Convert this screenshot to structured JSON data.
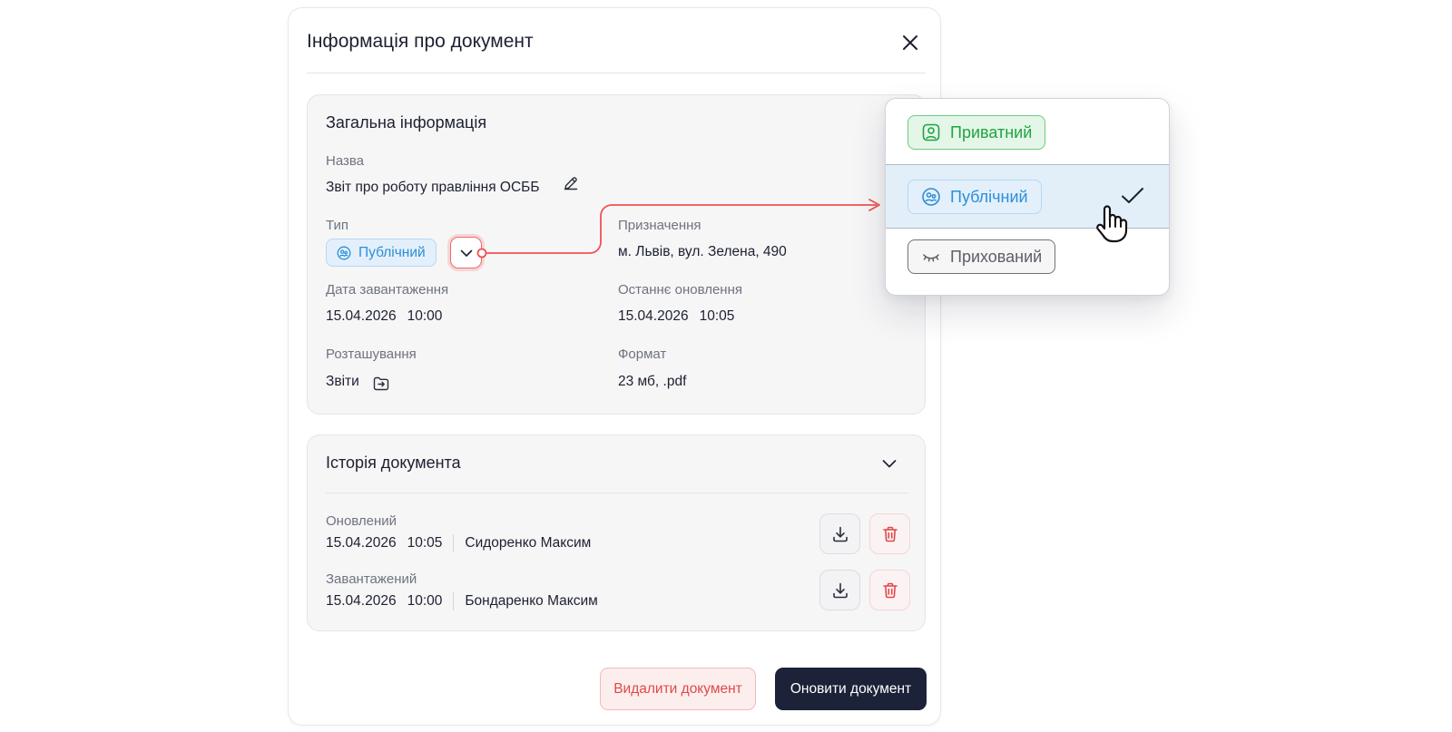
{
  "modal": {
    "title": "Інформація про документ"
  },
  "general": {
    "title": "Загальна інформація",
    "name_label": "Назва",
    "name_value": "Звіт про роботу правління ОСББ",
    "type_label": "Тип",
    "type_value": "Публічний",
    "purpose_label": "Призначення",
    "purpose_value": "м. Львів, вул. Зелена, 490",
    "upload_label": "Дата завантаження",
    "upload_date": "15.04.2026",
    "upload_time": "10:00",
    "updated_label": "Останнє оновлення",
    "updated_date": "15.04.2026",
    "updated_time": "10:05",
    "location_label": "Розташування",
    "location_value": "Звіти",
    "format_label": "Формат",
    "format_value": "23 мб, .pdf"
  },
  "history": {
    "title": "Історія документа",
    "entries": [
      {
        "status": "Оновлений",
        "date": "15.04.2026",
        "time": "10:05",
        "author": "Сидоренко Максим"
      },
      {
        "status": "Завантажений",
        "date": "15.04.2026",
        "time": "10:00",
        "author": "Бондаренко Максим"
      }
    ]
  },
  "footer": {
    "delete_label": "Видалити документ",
    "update_label": "Оновити документ"
  },
  "dropdown": {
    "options": [
      {
        "label": "Приватний",
        "icon": "person-square-icon",
        "selected": false
      },
      {
        "label": "Публічний",
        "icon": "people-circle-icon",
        "selected": true
      },
      {
        "label": "Прихований",
        "icon": "closed-eye-icon",
        "selected": false
      }
    ]
  },
  "colors": {
    "accent_red": "#f05252",
    "public_blue": "#2d8ed6",
    "private_green": "#21a341",
    "primary_dark": "#1c2238"
  }
}
